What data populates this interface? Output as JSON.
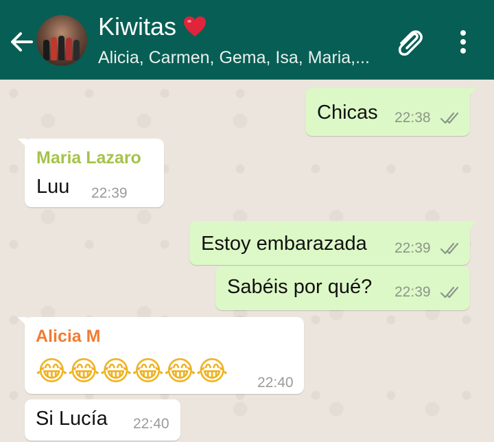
{
  "header": {
    "title": "Kiwitas",
    "title_emoji": "❤️",
    "subtitle": "Alicia, Carmen, Gema, Isa, Maria,...",
    "icons": {
      "back": "back-arrow-icon",
      "avatar": "group-avatar",
      "attach": "paperclip-icon",
      "menu": "more-vert-icon"
    },
    "colors": {
      "bar": "#075e54",
      "text": "#ffffff"
    }
  },
  "messages": [
    {
      "direction": "out",
      "text": "Chicas",
      "time": "22:38",
      "status": "delivered-double-check"
    },
    {
      "direction": "in",
      "sender": "Maria Lazaro",
      "sender_color": "#a5c34a",
      "text": "Luu",
      "time": "22:39"
    },
    {
      "direction": "out",
      "text": "Estoy embarazada",
      "time": "22:39",
      "status": "delivered-double-check"
    },
    {
      "direction": "out",
      "text": "Sabéis por qué?",
      "time": "22:39",
      "status": "delivered-double-check"
    },
    {
      "direction": "in",
      "sender": "Alicia M",
      "sender_color": "#f07c33",
      "emojis": "😂😂😂😂😂😂",
      "emoji_name": "face-with-tears-of-joy",
      "time": "22:40"
    },
    {
      "direction": "in",
      "text": "Si Lucía",
      "time": "22:40"
    }
  ],
  "colors": {
    "chat_background": "#ece5dd",
    "outgoing_bubble": "#dcf8c6",
    "incoming_bubble": "#ffffff",
    "ticks": "#8c958c"
  }
}
